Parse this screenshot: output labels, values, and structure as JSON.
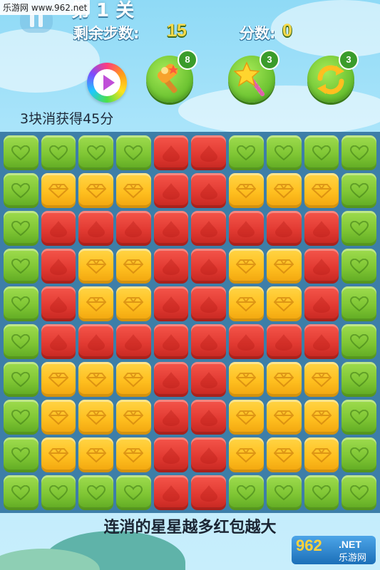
{
  "watermark": "乐游网 www.962.net",
  "level_title": "第 1 关",
  "steps": {
    "label": "剩余步数:",
    "value": "15"
  },
  "score": {
    "label": "分数:",
    "value": "0"
  },
  "tools": [
    {
      "name": "hammer",
      "icon": "hammer-icon",
      "count": "8"
    },
    {
      "name": "magic-wand",
      "icon": "star-wand-icon",
      "count": "3"
    },
    {
      "name": "refresh",
      "icon": "refresh-icon",
      "count": "3"
    }
  ],
  "hint": "3块消获得45分",
  "board": {
    "rows": [
      [
        "g",
        "g",
        "g",
        "g",
        "r",
        "r",
        "g",
        "g",
        "g",
        "g"
      ],
      [
        "g",
        "y",
        "y",
        "y",
        "r",
        "r",
        "y",
        "y",
        "y",
        "g"
      ],
      [
        "g",
        "r",
        "r",
        "r",
        "r",
        "r",
        "r",
        "r",
        "r",
        "g"
      ],
      [
        "g",
        "r",
        "y",
        "y",
        "r",
        "r",
        "y",
        "y",
        "r",
        "g"
      ],
      [
        "g",
        "r",
        "y",
        "y",
        "r",
        "r",
        "y",
        "y",
        "r",
        "g"
      ],
      [
        "g",
        "r",
        "r",
        "r",
        "r",
        "r",
        "r",
        "r",
        "r",
        "g"
      ],
      [
        "g",
        "y",
        "y",
        "y",
        "r",
        "r",
        "y",
        "y",
        "y",
        "g"
      ],
      [
        "g",
        "y",
        "y",
        "y",
        "r",
        "r",
        "y",
        "y",
        "y",
        "g"
      ],
      [
        "g",
        "y",
        "y",
        "y",
        "r",
        "r",
        "y",
        "y",
        "y",
        "g"
      ],
      [
        "g",
        "g",
        "g",
        "g",
        "r",
        "r",
        "g",
        "g",
        "g",
        "g"
      ]
    ],
    "colors": {
      "g": "#7fc634",
      "y": "#ffbf1f",
      "r": "#e23a32"
    },
    "shapes": {
      "g": "heart",
      "y": "diamond",
      "r": "drop"
    }
  },
  "footer_text": "连消的星星越多红包越大",
  "footer_logo": {
    "big": "962",
    "small": ".NET",
    "cn": "乐游网"
  }
}
